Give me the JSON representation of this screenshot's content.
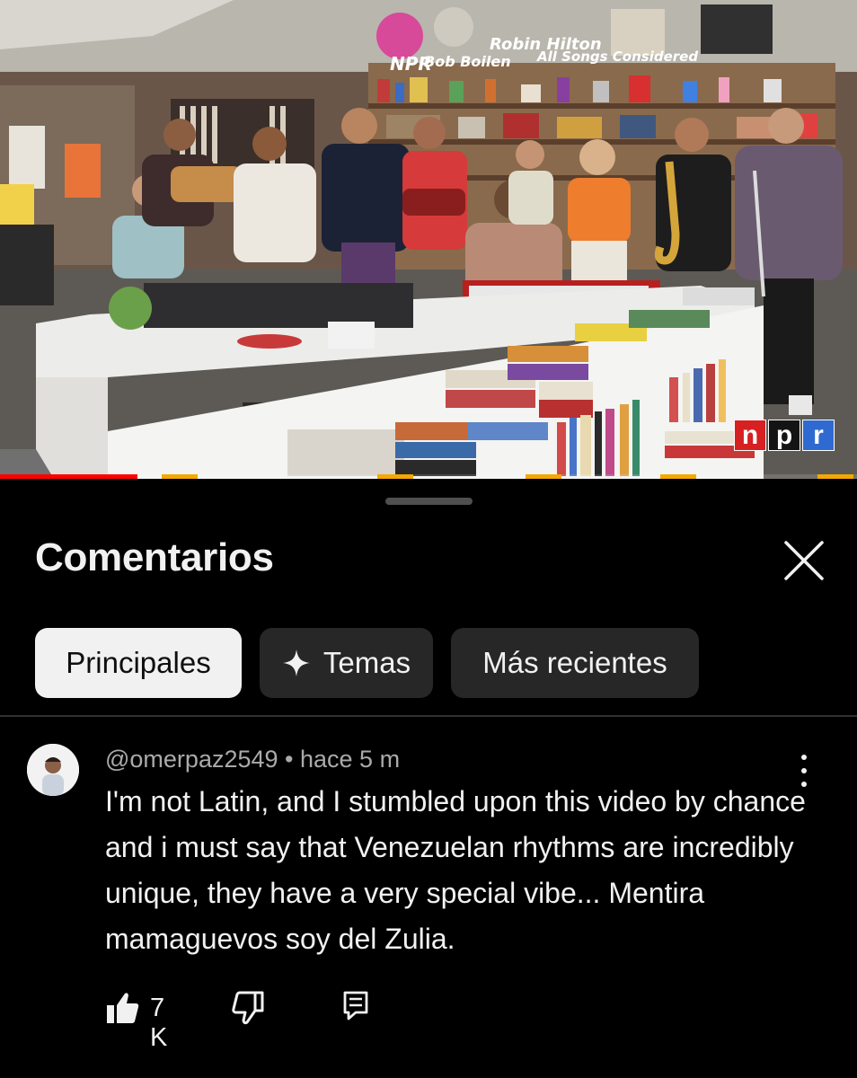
{
  "video": {
    "brand_badge": [
      "n",
      "p",
      "r"
    ],
    "sign_text": {
      "npr": "NPR",
      "bob_boilen": "Bob Boilen",
      "robin_hilton": "Robin Hilton",
      "all_songs": "All Songs Considered"
    },
    "progress_fraction": 0.16,
    "colors": {
      "progress": "#ff0000",
      "chapter_marker": "#f2a900"
    }
  },
  "sheet": {
    "title": "Comentarios",
    "close_icon": "close-icon",
    "chips": [
      {
        "label": "Principales",
        "selected": true
      },
      {
        "label": "Temas",
        "icon": "sparkle-icon",
        "selected": false
      },
      {
        "label": "Más recientes",
        "selected": false
      }
    ]
  },
  "comment": {
    "author": "@omerpaz2549",
    "separator": " • ",
    "time": "hace 5 m",
    "text": "I'm not Latin, and I stumbled upon this video by chance and i must say that Venezuelan rhythms are incredibly unique, they have a very special vibe... Mentira mamaguevos soy del Zulia.",
    "likes": "7 K",
    "icons": [
      "like-icon",
      "dislike-icon",
      "reply-icon",
      "more-vert-icon"
    ]
  }
}
